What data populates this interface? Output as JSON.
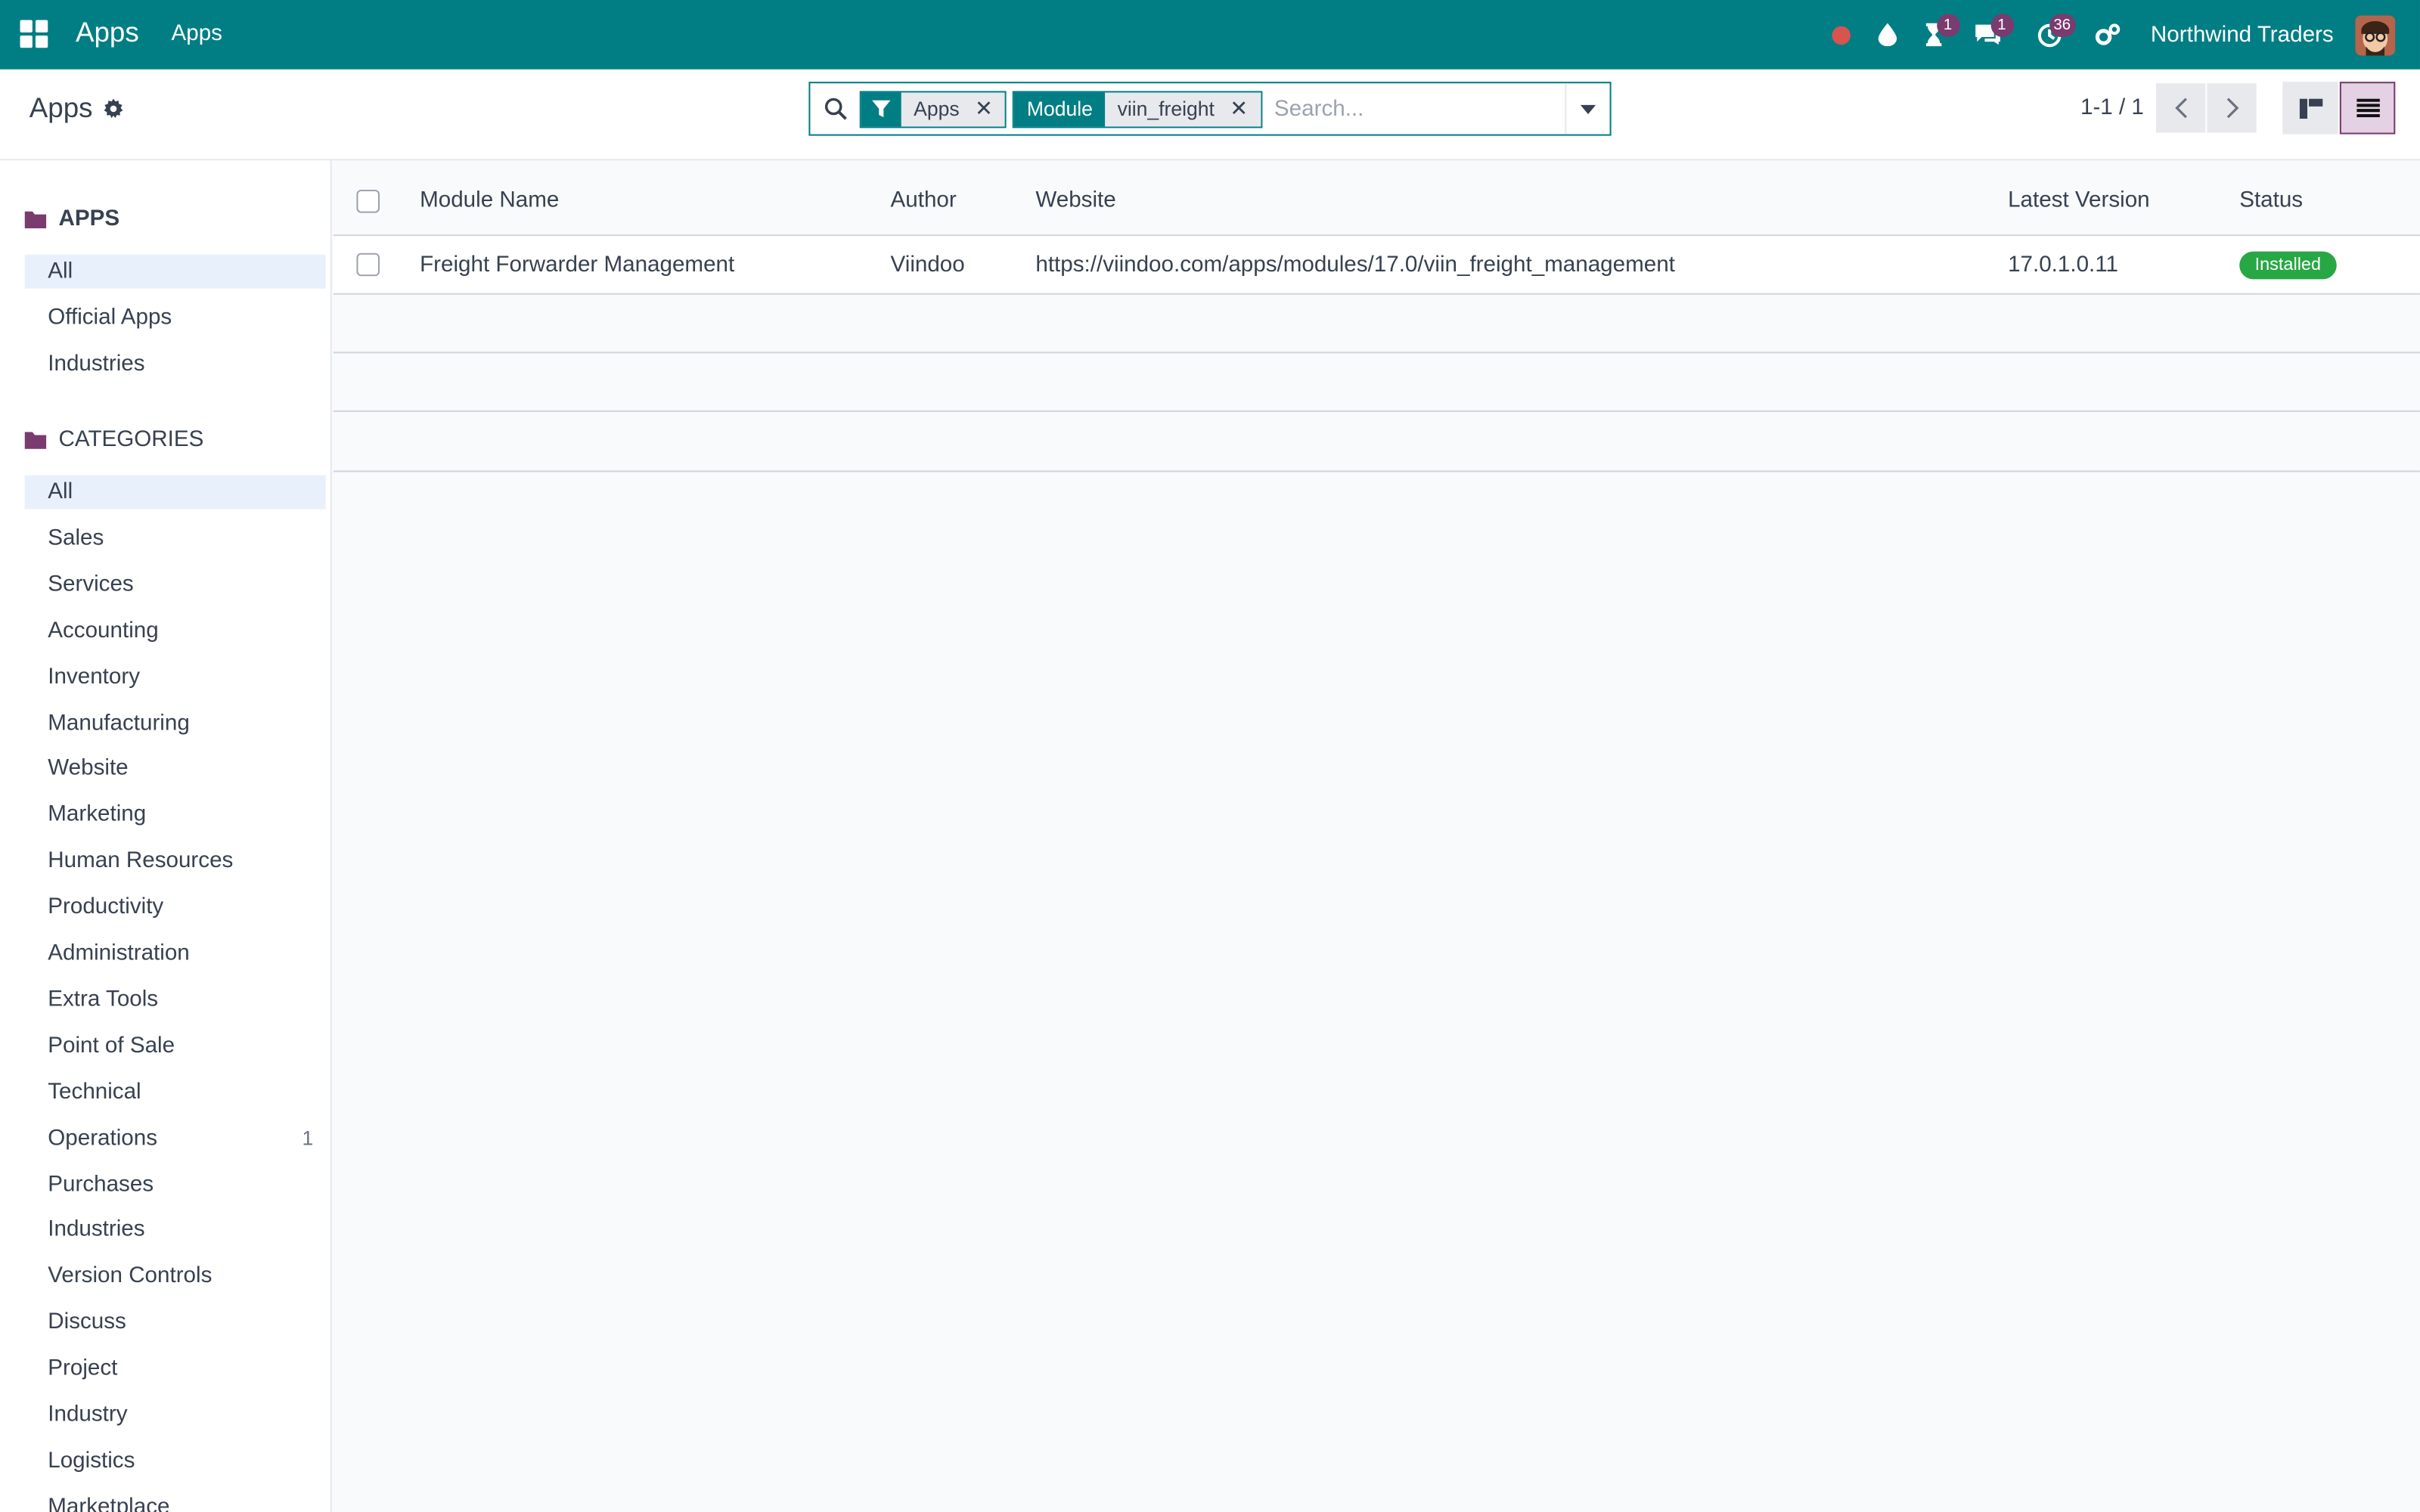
{
  "navbar": {
    "brand": "Apps",
    "menu_apps": "Apps",
    "badges": {
      "activities": "1",
      "messages": "1",
      "timers": "36"
    },
    "company": "Northwind Traders"
  },
  "control": {
    "breadcrumb": "Apps",
    "search": {
      "facet_filter_value": "Apps",
      "facet_module_label": "Module",
      "facet_module_value": "viin_freight",
      "placeholder": "Search..."
    },
    "pager": "1-1 / 1"
  },
  "sidebar": {
    "apps_header": "APPS",
    "apps_items": [
      "All",
      "Official Apps",
      "Industries"
    ],
    "categories_header": "CATEGORIES",
    "categories": [
      {
        "label": "All",
        "count": ""
      },
      {
        "label": "Sales",
        "count": ""
      },
      {
        "label": "Services",
        "count": ""
      },
      {
        "label": "Accounting",
        "count": ""
      },
      {
        "label": "Inventory",
        "count": ""
      },
      {
        "label": "Manufacturing",
        "count": ""
      },
      {
        "label": "Website",
        "count": ""
      },
      {
        "label": "Marketing",
        "count": ""
      },
      {
        "label": "Human Resources",
        "count": ""
      },
      {
        "label": "Productivity",
        "count": ""
      },
      {
        "label": "Administration",
        "count": ""
      },
      {
        "label": "Extra Tools",
        "count": ""
      },
      {
        "label": "Point of Sale",
        "count": ""
      },
      {
        "label": "Technical",
        "count": ""
      },
      {
        "label": "Operations",
        "count": "1"
      },
      {
        "label": "Purchases",
        "count": ""
      },
      {
        "label": "Industries",
        "count": ""
      },
      {
        "label": "Version Controls",
        "count": ""
      },
      {
        "label": "Discuss",
        "count": ""
      },
      {
        "label": "Project",
        "count": ""
      },
      {
        "label": "Industry",
        "count": ""
      },
      {
        "label": "Logistics",
        "count": ""
      },
      {
        "label": "Marketplace",
        "count": ""
      }
    ]
  },
  "table": {
    "headers": {
      "name": "Module Name",
      "author": "Author",
      "website": "Website",
      "version": "Latest Version",
      "status": "Status"
    },
    "rows": [
      {
        "name": "Freight Forwarder Management",
        "author": "Viindoo",
        "website": "https://viindoo.com/apps/modules/17.0/viin_freight_management",
        "version": "17.0.1.0.11",
        "status": "Installed"
      }
    ]
  },
  "colors": {
    "brand": "#017e84",
    "badge": "#7a3b6e",
    "installed": "#28a745",
    "folder": "#7a3b6e"
  }
}
